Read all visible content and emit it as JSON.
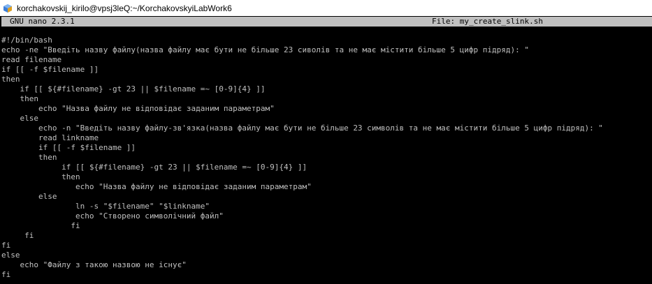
{
  "window": {
    "title": "korchakovskij_kirilo@vpsj3leQ:~/KorchakovskyiLabWork6",
    "icon": "terminal-app-icon"
  },
  "nano": {
    "version": "GNU nano 2.3.1",
    "file_label": "File: my_create_slink.sh"
  },
  "colors": {
    "background": "#000000",
    "text": "#c0c0c0",
    "header_bg": "#c0c0c0",
    "titlebar_bg": "#ffffff"
  },
  "code": {
    "lines": [
      "#!/bin/bash",
      "echo -ne \"Введіть назву файлу(назва файлу має бути не більше 23 сиволів та не має містити більше 5 цифр підряд): \"",
      "read filename",
      "if [[ -f $filename ]]",
      "then",
      "    if [[ ${#filename} -gt 23 || $filename =~ [0-9]{4} ]]",
      "    then",
      "        echo \"Назва файлу не відповідає заданим параметрам\"",
      "    else",
      "        echo -n \"Введіть назву файлу-зв'язка(назва файлу має бути не більше 23 символів та не має містити більше 5 цифр підряд): \"",
      "        read linkname",
      "        if [[ -f $filename ]]",
      "        then",
      "             if [[ ${#filename} -gt 23 || $filename =~ [0-9]{4} ]]",
      "             then",
      "                echo \"Назва файлу не відповідає заданим параметрам\"",
      "        else",
      "                ln -s \"$filename\" \"$linkname\"",
      "                echo \"Створено символічний файл\"",
      "               fi",
      "     fi",
      "fi",
      "else",
      "    echo \"Файлу з такою назвою не існує\"",
      "fi"
    ]
  }
}
